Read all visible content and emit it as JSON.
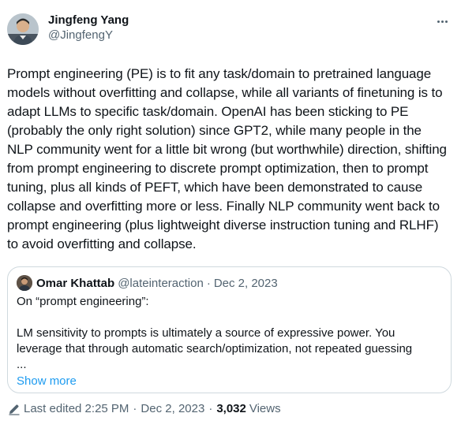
{
  "author": {
    "display_name": "Jingfeng Yang",
    "handle": "@JingfengY"
  },
  "tweet_text": "Prompt engineering (PE) is to fit any task/domain to pretrained language models without overfitting and collapse, while all variants of finetuning is to adapt LLMs to specific task/domain. OpenAI has been sticking to PE (probably the only right solution) since GPT2, while many people in the NLP community went for a little bit wrong (but worthwhile) direction, shifting from prompt engineering to discrete prompt optimization, then to prompt tuning, plus all kinds of PEFT, which have been demonstrated to cause collapse and overfitting more or less. Finally NLP community went back to prompt engineering (plus lightweight diverse instruction tuning and RLHF) to avoid overfitting and collapse.",
  "quote": {
    "display_name": "Omar Khattab",
    "handle": "@lateinteraction",
    "separator": "·",
    "date": "Dec 2, 2023",
    "text": "On “prompt engineering”:\n\nLM sensitivity to prompts is ultimately a source of expressive power. You leverage that through automatic search/optimization, not repeated guessing\n...",
    "show_more": "Show more"
  },
  "footer": {
    "edited_label": "Last edited 2:25 PM",
    "separator": "·",
    "date": "Dec 2, 2023",
    "views_count": "3,032",
    "views_label": "Views"
  },
  "icons": {
    "more": "more-horizontal-icon",
    "edit": "pencil-icon"
  }
}
